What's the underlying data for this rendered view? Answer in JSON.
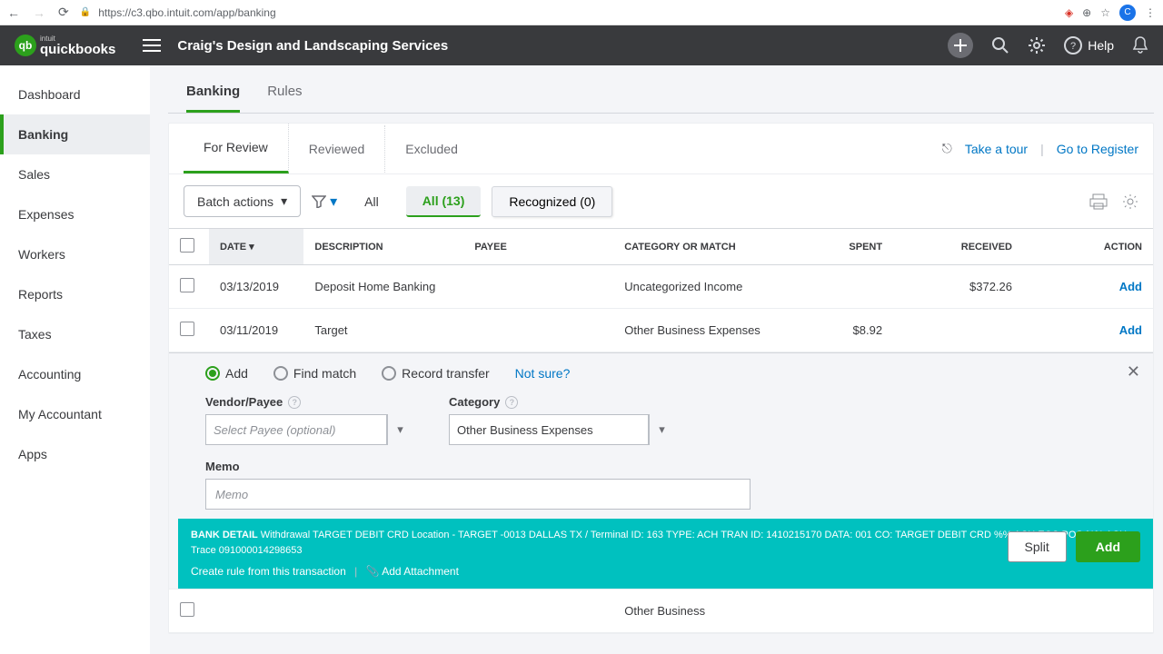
{
  "browser": {
    "url": "https://c3.qbo.intuit.com/app/banking",
    "avatar_initial": "C"
  },
  "header": {
    "brand_small": "intuit",
    "brand": "quickbooks",
    "company_name": "Craig's Design and Landscaping Services",
    "help_label": "Help"
  },
  "sidebar": {
    "items": [
      {
        "label": "Dashboard"
      },
      {
        "label": "Banking"
      },
      {
        "label": "Sales"
      },
      {
        "label": "Expenses"
      },
      {
        "label": "Workers"
      },
      {
        "label": "Reports"
      },
      {
        "label": "Taxes"
      },
      {
        "label": "Accounting"
      },
      {
        "label": "My Accountant"
      },
      {
        "label": "Apps"
      }
    ]
  },
  "subtabs": {
    "banking": "Banking",
    "rules": "Rules"
  },
  "review_tabs": {
    "for_review": "For Review",
    "reviewed": "Reviewed",
    "excluded": "Excluded",
    "take_tour": "Take a tour",
    "go_register": "Go to Register"
  },
  "toolbar": {
    "batch": "Batch actions",
    "all": "All",
    "all_count": "All (13)",
    "recognized": "Recognized (0)"
  },
  "table": {
    "headers": {
      "date": "DATE",
      "description": "DESCRIPTION",
      "payee": "PAYEE",
      "category": "CATEGORY OR MATCH",
      "spent": "SPENT",
      "received": "RECEIVED",
      "action": "ACTION"
    },
    "rows": [
      {
        "date": "03/13/2019",
        "description": "Deposit Home Banking",
        "payee": "",
        "category": "Uncategorized Income",
        "spent": "",
        "received": "$372.26",
        "action": "Add"
      },
      {
        "date": "03/11/2019",
        "description": "Target",
        "payee": "",
        "category": "Other Business Expenses",
        "spent": "$8.92",
        "received": "",
        "action": "Add"
      }
    ],
    "partial_row_category": "Other Business"
  },
  "detail": {
    "radios": {
      "add": "Add",
      "find": "Find match",
      "transfer": "Record transfer",
      "notsure": "Not sure?"
    },
    "vendor_label": "Vendor/Payee",
    "vendor_placeholder": "Select Payee (optional)",
    "category_label": "Category",
    "category_value": "Other Business Expenses",
    "memo_label": "Memo",
    "memo_placeholder": "Memo",
    "bank_label": "BANK DETAIL",
    "bank_text": "Withdrawal TARGET DEBIT CRD Location - TARGET -0013 DALLAS TX / Terminal ID: 163 TYPE: ACH TRAN ID: 1410215170 DATA: 001 CO: TARGET DEBIT CRD %% ACH ECC POS %% ACH Trace 091000014298653",
    "create_rule": "Create rule from this transaction",
    "attachment": "Add Attachment",
    "split": "Split",
    "add_btn": "Add"
  }
}
